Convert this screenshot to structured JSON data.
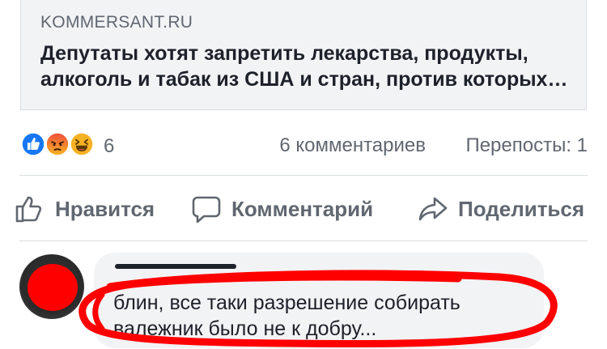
{
  "link_preview": {
    "domain": "KOMMERSANT.RU",
    "title": "Депутаты хотят запретить лекарства, продукты, алкоголь и табак из США и стран, против которых вводятся санкции"
  },
  "stats": {
    "reactions": [
      "like-icon",
      "angry-icon",
      "haha-icon"
    ],
    "reaction_count": "6",
    "comments": "6 комментариев",
    "shares": "Перепосты: 1"
  },
  "actions": {
    "like_label": "Нравится",
    "comment_label": "Комментарий",
    "share_label": "Поделиться"
  },
  "comment": {
    "text": "блин, все таки разрешение собирать валежник было не к добру..."
  },
  "colors": {
    "like_blue": "#1877f2",
    "angry_orange": "#f0503a",
    "haha_yellow": "#f7b125",
    "annotation_red": "#ff0000"
  }
}
